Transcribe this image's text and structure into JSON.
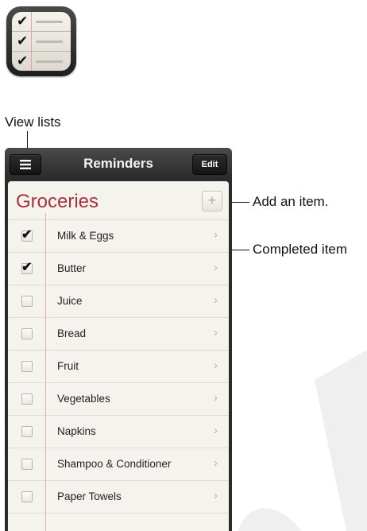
{
  "callouts": {
    "view_lists": "View lists",
    "add_item": "Add an item.",
    "completed_item": "Completed item"
  },
  "nav": {
    "title": "Reminders",
    "edit_label": "Edit",
    "menu_icon": "list-icon"
  },
  "list": {
    "title": "Groceries",
    "add_glyph": "+",
    "items": [
      {
        "label": "Milk & Eggs",
        "checked": true
      },
      {
        "label": "Butter",
        "checked": true
      },
      {
        "label": "Juice",
        "checked": false
      },
      {
        "label": "Bread",
        "checked": false
      },
      {
        "label": "Fruit",
        "checked": false
      },
      {
        "label": "Vegetables",
        "checked": false
      },
      {
        "label": "Napkins",
        "checked": false
      },
      {
        "label": "Shampoo & Conditioner",
        "checked": false
      },
      {
        "label": "Paper Towels",
        "checked": false
      }
    ]
  },
  "colors": {
    "list_title": "#a8323e",
    "margin_line": "#e8a6ab"
  }
}
